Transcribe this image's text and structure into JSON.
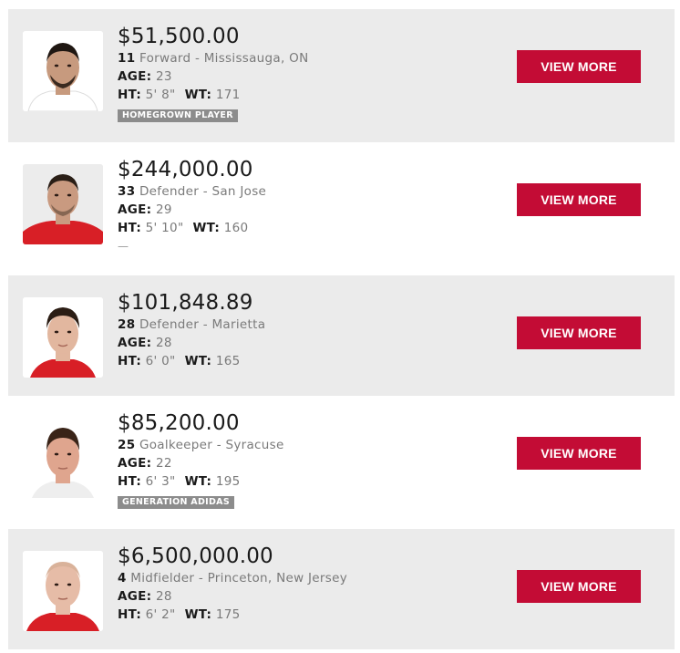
{
  "players": [
    {
      "salary": "$51,500.00",
      "number": "11",
      "position_hometown": " Forward - Mississauga, ON",
      "age_label": "AGE:",
      "age": " 23",
      "ht_label": "HT:",
      "height": " 5' 8\"",
      "wt_label": "WT:",
      "weight": " 171",
      "badge": "HOMEGROWN PLAYER",
      "button": "VIEW MORE",
      "skin": "#c79a7e",
      "hair": "#1f1712",
      "jersey": "#ffffff"
    },
    {
      "salary": "$244,000.00",
      "number": "33",
      "position_hometown": " Defender - San Jose",
      "age_label": "AGE:",
      "age": " 29",
      "ht_label": "HT:",
      "height": " 5' 10\"",
      "wt_label": "WT:",
      "weight": " 160",
      "badge_placeholder": "—",
      "button": "VIEW MORE",
      "skin": "#c99a80",
      "hair": "#2a1e16",
      "jersey": "#d81f26"
    },
    {
      "salary": "$101,848.89",
      "number": "28",
      "position_hometown": " Defender - Marietta",
      "age_label": "AGE:",
      "age": " 28",
      "ht_label": "HT:",
      "height": " 6' 0\"",
      "wt_label": "WT:",
      "weight": " 165",
      "button": "VIEW MORE",
      "skin": "#e2b79f",
      "hair": "#2b1d14",
      "jersey": "#d81f26"
    },
    {
      "salary": "$85,200.00",
      "number": "25",
      "position_hometown": " Goalkeeper - Syracuse",
      "age_label": "AGE:",
      "age": " 22",
      "ht_label": "HT:",
      "height": " 6' 3\"",
      "wt_label": "WT:",
      "weight": " 195",
      "badge": "GENERATION ADIDAS",
      "button": "VIEW MORE",
      "skin": "#dfa58e",
      "hair": "#3a2418",
      "jersey": "#ffffff"
    },
    {
      "salary": "$6,500,000.00",
      "number": "4",
      "position_hometown": " Midfielder - Princeton, New Jersey",
      "age_label": "AGE:",
      "age": " 28",
      "ht_label": "HT:",
      "height": " 6' 2\"",
      "wt_label": "WT:",
      "weight": " 175",
      "button": "VIEW MORE",
      "skin": "#e6bca7",
      "hair": "#d9b29a",
      "jersey": "#d81f26"
    }
  ]
}
